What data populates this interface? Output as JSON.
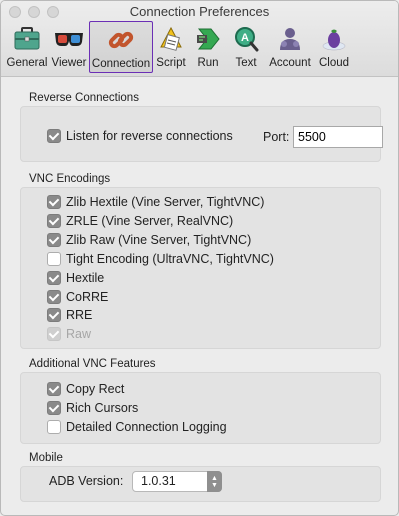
{
  "window": {
    "title": "Connection Preferences"
  },
  "toolbar": {
    "items": [
      {
        "label": "General",
        "icon": "toolbox-icon"
      },
      {
        "label": "Viewer",
        "icon": "3d-glasses-icon"
      },
      {
        "label": "Connection",
        "icon": "chain-link-icon",
        "active": true
      },
      {
        "label": "Script",
        "icon": "script-icon"
      },
      {
        "label": "Run",
        "icon": "run-icon"
      },
      {
        "label": "Text",
        "icon": "text-icon"
      },
      {
        "label": "Account",
        "icon": "account-icon"
      },
      {
        "label": "Cloud",
        "icon": "eggplant-icon"
      }
    ]
  },
  "reverse": {
    "title": "Reverse Connections",
    "listen_label": "Listen for reverse connections",
    "listen_checked": true,
    "port_label": "Port:",
    "port_value": "5500"
  },
  "encodings": {
    "title": "VNC Encodings",
    "items": [
      {
        "label": "Zlib Hextile (Vine Server, TightVNC)",
        "checked": true
      },
      {
        "label": "ZRLE (Vine Server, RealVNC)",
        "checked": true
      },
      {
        "label": "Zlib Raw (Vine Server, TightVNC)",
        "checked": true
      },
      {
        "label": "Tight Encoding (UltraVNC, TightVNC)",
        "checked": false
      },
      {
        "label": "Hextile",
        "checked": true
      },
      {
        "label": "CoRRE",
        "checked": true
      },
      {
        "label": "RRE",
        "checked": true
      },
      {
        "label": "Raw",
        "checked": true,
        "disabled": true
      }
    ]
  },
  "features": {
    "title": "Additional VNC Features",
    "items": [
      {
        "label": "Copy Rect",
        "checked": true
      },
      {
        "label": "Rich Cursors",
        "checked": true
      },
      {
        "label": "Detailed Connection Logging",
        "checked": false
      }
    ]
  },
  "mobile": {
    "title": "Mobile",
    "adb_label": "ADB Version:",
    "adb_value": "1.0.31"
  },
  "colors": {
    "active_tab_border": "#6b2fb5",
    "checkbox_checked": "#8a8a8a"
  }
}
